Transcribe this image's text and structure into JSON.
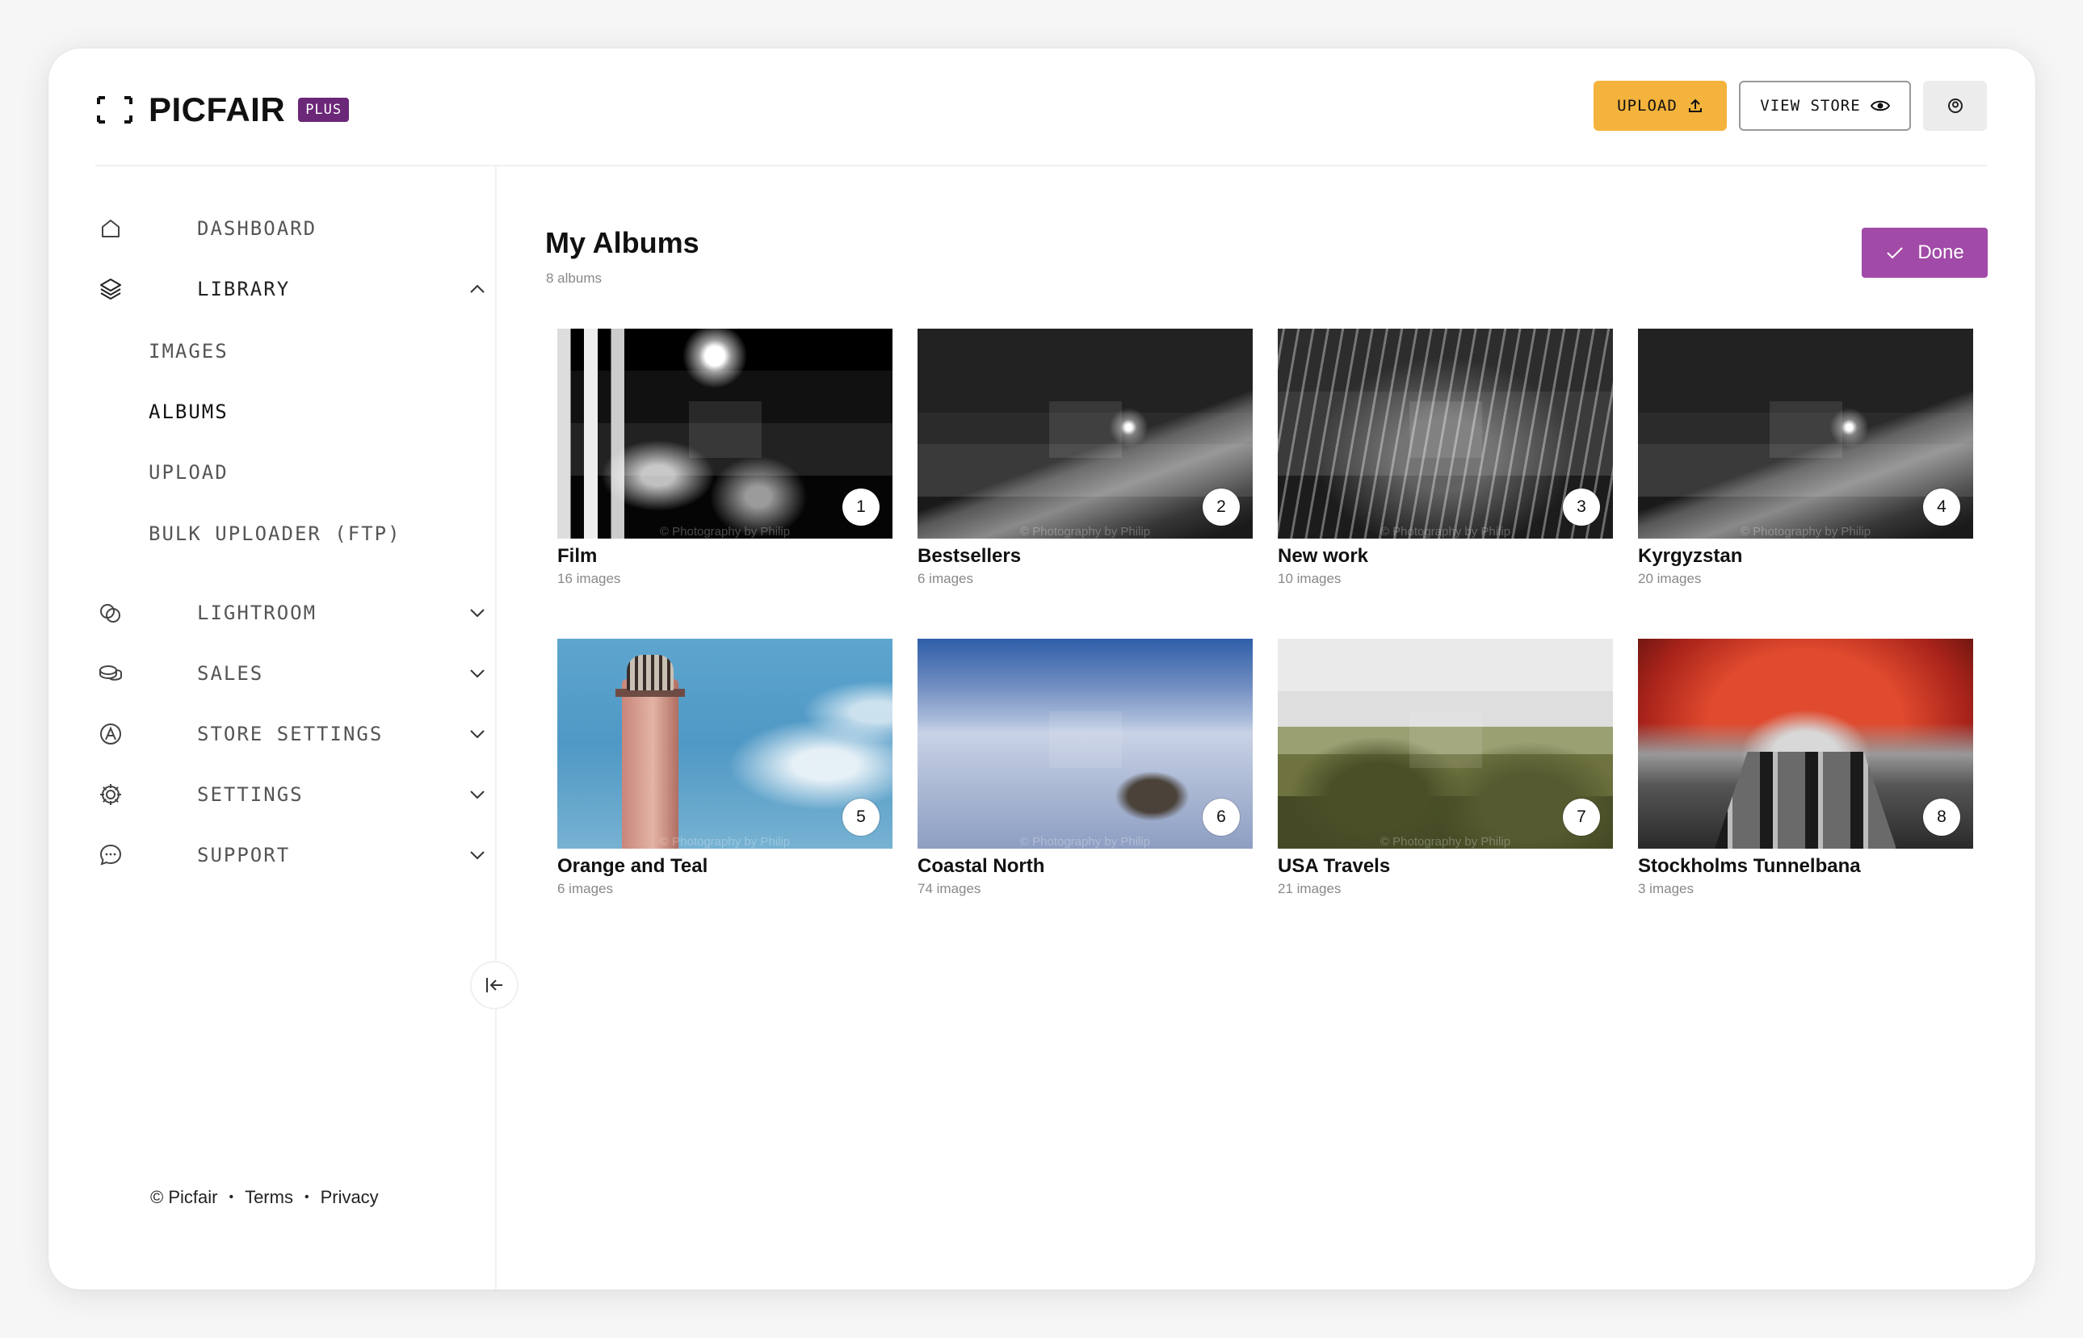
{
  "app": {
    "brand": "PICFAIR",
    "plan_badge": "PLUS"
  },
  "header": {
    "upload_label": "UPLOAD",
    "view_store_label": "VIEW STORE"
  },
  "sidebar": {
    "dashboard": "DASHBOARD",
    "library": "LIBRARY",
    "library_sub": {
      "images": "IMAGES",
      "albums": "ALBUMS",
      "upload": "UPLOAD",
      "bulk": "BULK UPLOADER (FTP)"
    },
    "lightroom": "LIGHTROOM",
    "sales": "SALES",
    "store_settings": "STORE SETTINGS",
    "settings": "SETTINGS",
    "support": "SUPPORT"
  },
  "footer": {
    "copyright": "© Picfair",
    "terms": "Terms",
    "privacy": "Privacy"
  },
  "main": {
    "title": "My Albums",
    "count": "8 albums",
    "done_label": "Done",
    "watermark": "© Photography by Philip",
    "albums": [
      {
        "number": "1",
        "name": "Film",
        "count": "16 images"
      },
      {
        "number": "2",
        "name": "Bestsellers",
        "count": "6 images"
      },
      {
        "number": "3",
        "name": "New work",
        "count": "10 images"
      },
      {
        "number": "4",
        "name": "Kyrgyzstan",
        "count": "20 images"
      },
      {
        "number": "5",
        "name": "Orange and Teal",
        "count": "6 images"
      },
      {
        "number": "6",
        "name": "Coastal North",
        "count": "74 images"
      },
      {
        "number": "7",
        "name": "USA Travels",
        "count": "21 images"
      },
      {
        "number": "8",
        "name": "Stockholms Tunnelbana",
        "count": "3 images"
      }
    ]
  },
  "colors": {
    "upload_button": "#f4b33c",
    "plus_badge": "#6b2778",
    "done_button": "#a14aa8"
  },
  "icons": {
    "upload": "upload-icon",
    "view_store": "eye-icon",
    "account": "account-icon",
    "dashboard": "home-icon",
    "library": "layers-icon",
    "lightroom": "lightroom-icon",
    "sales": "coins-icon",
    "store_settings": "store-icon",
    "settings": "gear-icon",
    "support": "chat-icon",
    "collapse": "collapse-sidebar-icon",
    "done": "check-icon"
  }
}
